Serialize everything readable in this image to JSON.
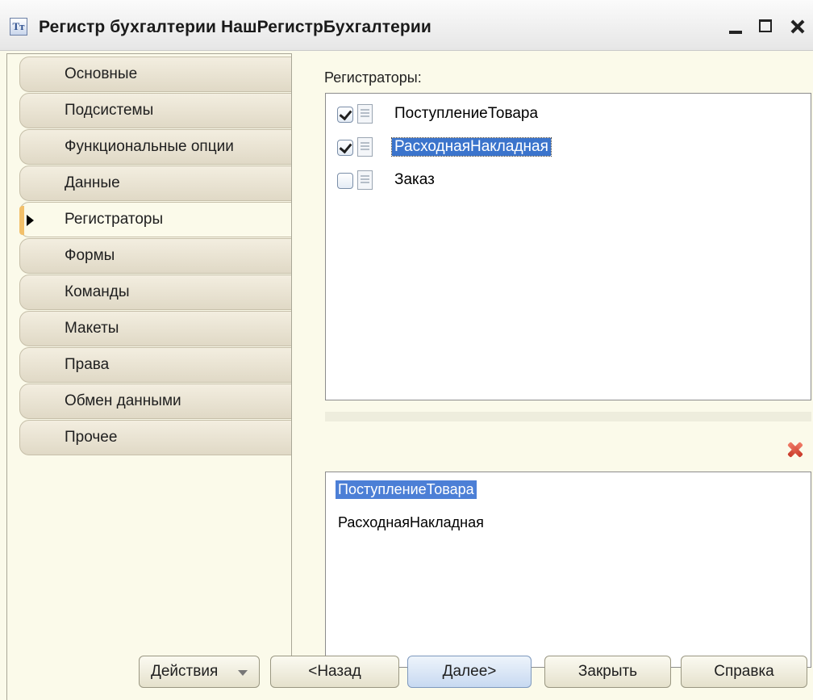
{
  "window": {
    "title": "Регистр бухгалтерии НашРегистрБухгалтерии",
    "app_icon_glyph": "Тт"
  },
  "tabs": [
    {
      "label": "Основные",
      "active": false
    },
    {
      "label": "Подсистемы",
      "active": false
    },
    {
      "label": "Функциональные опции",
      "active": false
    },
    {
      "label": "Данные",
      "active": false
    },
    {
      "label": "Регистраторы",
      "active": true
    },
    {
      "label": "Формы",
      "active": false
    },
    {
      "label": "Команды",
      "active": false
    },
    {
      "label": "Макеты",
      "active": false
    },
    {
      "label": "Права",
      "active": false
    },
    {
      "label": "Обмен данными",
      "active": false
    },
    {
      "label": "Прочее",
      "active": false
    }
  ],
  "registrators": {
    "label": "Регистраторы:",
    "items": [
      {
        "name": "ПоступлениеТовара",
        "checked": true,
        "selected": false
      },
      {
        "name": "РасходнаяНакладная",
        "checked": true,
        "selected": true
      },
      {
        "name": "Заказ",
        "checked": false,
        "selected": false
      }
    ]
  },
  "selected_list": {
    "items": [
      {
        "name": "ПоступлениеТовара",
        "selected": true
      },
      {
        "name": "РасходнаяНакладная",
        "selected": false
      }
    ]
  },
  "buttons": {
    "actions": "Действия",
    "back": "<Назад",
    "next": "Далее>",
    "close": "Закрыть",
    "help": "Справка"
  },
  "colors": {
    "selection": "#3b74cc",
    "panel_bg": "#fbfaea",
    "tab_bg": "#e0d9c6",
    "active_tab_marker": "#f2c06b",
    "delete_icon": "#c93a2a"
  }
}
